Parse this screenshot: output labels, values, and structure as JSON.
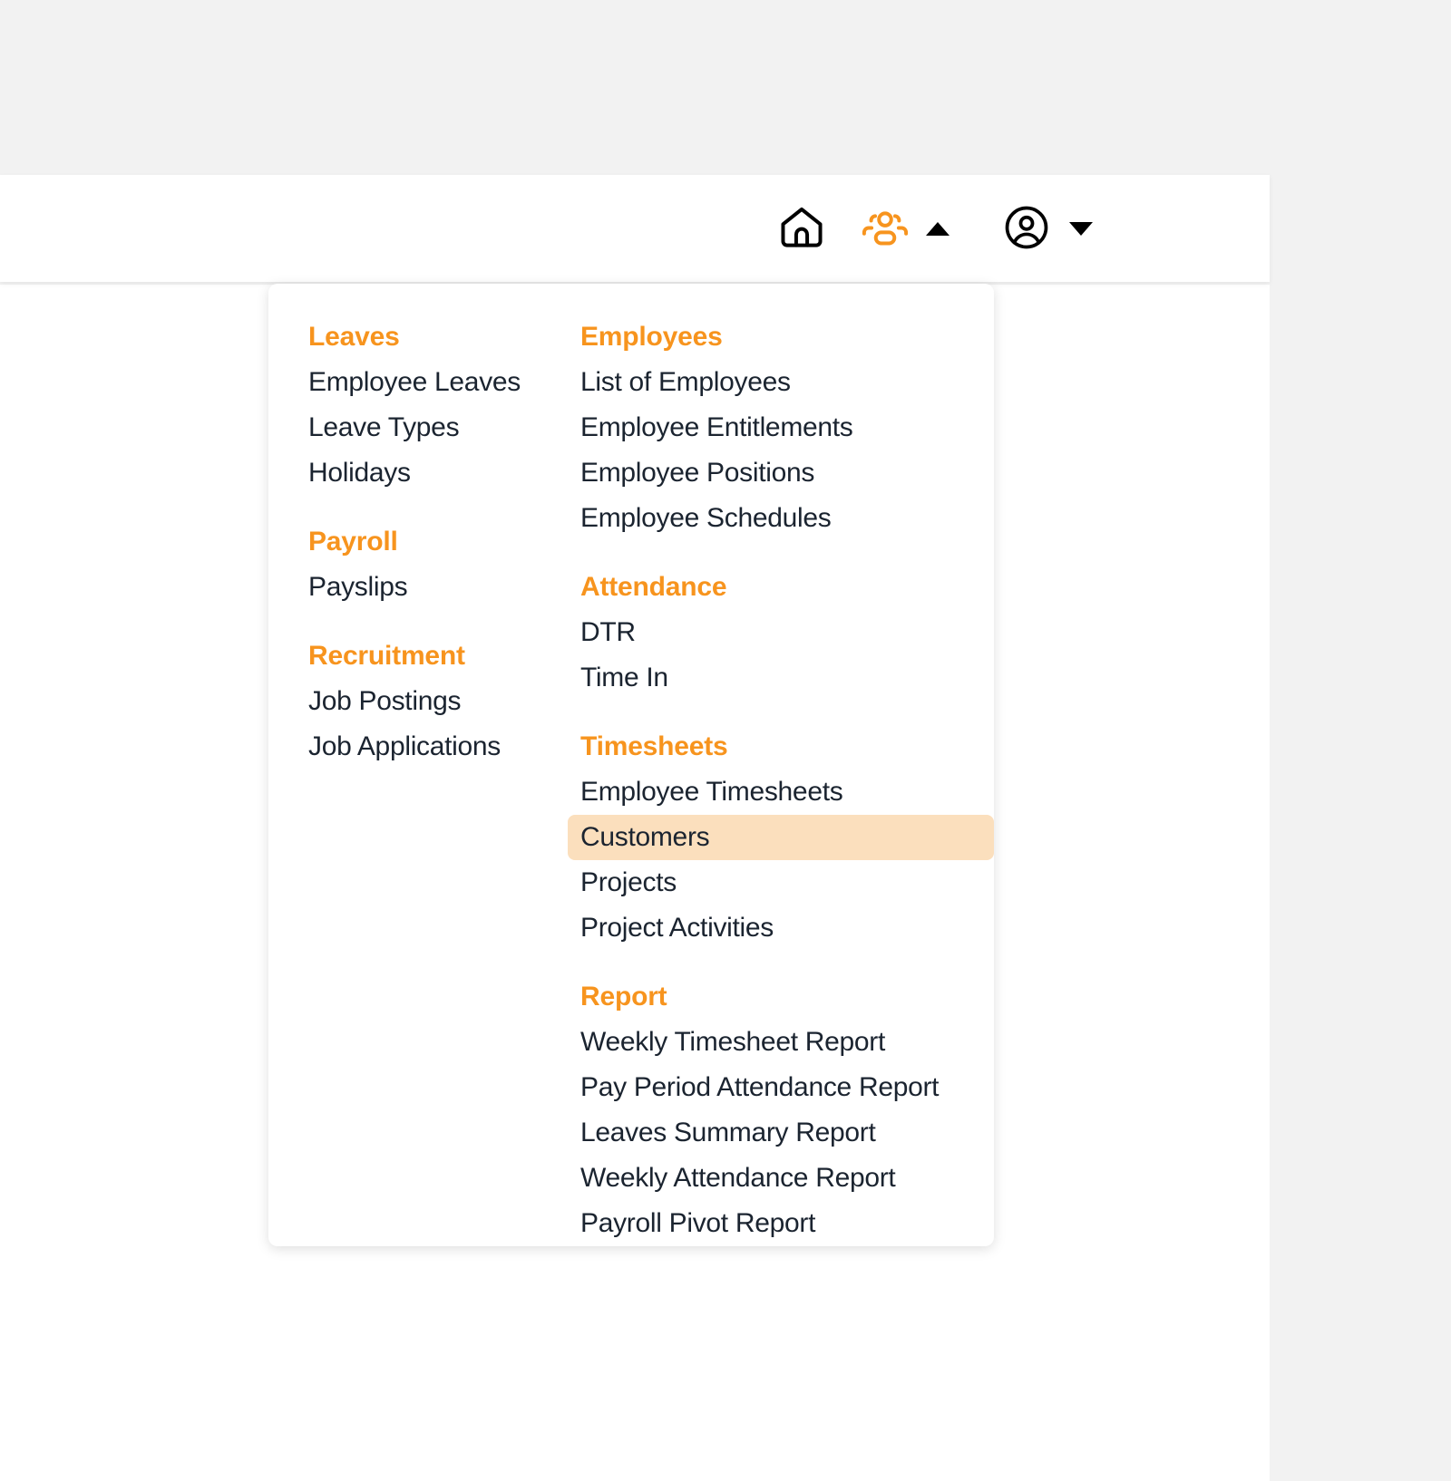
{
  "theme": {
    "page_background": "#f2f2f2",
    "surface": "#ffffff",
    "accent": "#f7941e",
    "text": "#1b2430",
    "active_item_background": "#fbdfbd"
  },
  "topbar": {
    "icons": [
      {
        "name": "home-icon",
        "label": "Home"
      },
      {
        "name": "people-icon",
        "label": "HR Module",
        "active": true
      },
      {
        "name": "caret-up-icon",
        "label": "Collapse HR menu"
      },
      {
        "name": "account-circle-icon",
        "label": "Account"
      },
      {
        "name": "caret-down-icon",
        "label": "Open account menu"
      }
    ]
  },
  "mega_menu": {
    "columns": [
      {
        "id": "left",
        "groups": [
          {
            "title": "Leaves",
            "items": [
              {
                "label": "Employee Leaves",
                "active": false
              },
              {
                "label": "Leave Types",
                "active": false
              },
              {
                "label": "Holidays",
                "active": false
              }
            ]
          },
          {
            "title": "Payroll",
            "items": [
              {
                "label": "Payslips",
                "active": false
              }
            ]
          },
          {
            "title": "Recruitment",
            "items": [
              {
                "label": "Job Postings",
                "active": false
              },
              {
                "label": "Job Applications",
                "active": false
              }
            ]
          }
        ]
      },
      {
        "id": "right",
        "groups": [
          {
            "title": "Employees",
            "items": [
              {
                "label": "List of Employees",
                "active": false
              },
              {
                "label": "Employee Entitlements",
                "active": false
              },
              {
                "label": "Employee Positions",
                "active": false
              },
              {
                "label": "Employee Schedules",
                "active": false
              }
            ]
          },
          {
            "title": "Attendance",
            "items": [
              {
                "label": "DTR",
                "active": false
              },
              {
                "label": "Time In",
                "active": false
              }
            ]
          },
          {
            "title": "Timesheets",
            "items": [
              {
                "label": "Employee Timesheets",
                "active": false
              },
              {
                "label": "Customers",
                "active": true
              },
              {
                "label": "Projects",
                "active": false
              },
              {
                "label": "Project Activities",
                "active": false
              }
            ]
          },
          {
            "title": "Report",
            "items": [
              {
                "label": "Weekly Timesheet Report",
                "active": false
              },
              {
                "label": "Pay Period Attendance Report",
                "active": false
              },
              {
                "label": "Leaves Summary Report",
                "active": false
              },
              {
                "label": "Weekly Attendance Report",
                "active": false
              },
              {
                "label": "Payroll Pivot Report",
                "active": false
              }
            ]
          }
        ]
      }
    ]
  }
}
